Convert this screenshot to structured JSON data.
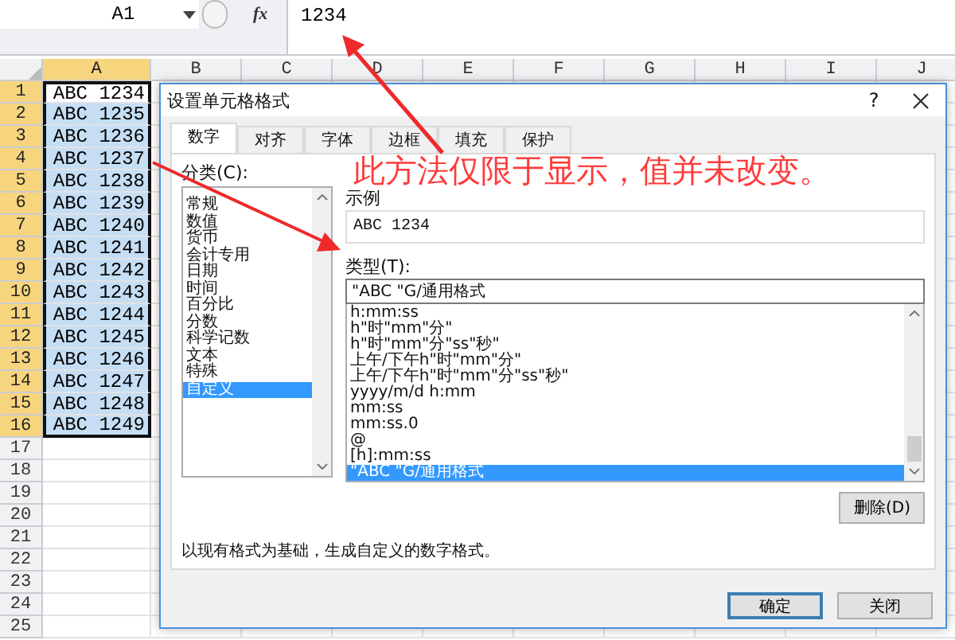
{
  "formula_bar": {
    "name_box": "A1",
    "function_label": "fx",
    "value": "1234"
  },
  "sheet": {
    "columns": [
      {
        "label": "A",
        "selected": true
      },
      {
        "label": "B",
        "selected": false
      },
      {
        "label": "C",
        "selected": false
      },
      {
        "label": "D",
        "selected": false
      },
      {
        "label": "E",
        "selected": false
      },
      {
        "label": "F",
        "selected": false
      },
      {
        "label": "G",
        "selected": false
      },
      {
        "label": "H",
        "selected": false
      },
      {
        "label": "I",
        "selected": false
      },
      {
        "label": "J",
        "selected": false
      }
    ],
    "rows": [
      {
        "label": "1",
        "selected": true,
        "active": true,
        "cell": "ABC 1234"
      },
      {
        "label": "2",
        "selected": true,
        "active": false,
        "cell": "ABC 1235"
      },
      {
        "label": "3",
        "selected": true,
        "active": false,
        "cell": "ABC 1236"
      },
      {
        "label": "4",
        "selected": true,
        "active": false,
        "cell": "ABC 1237"
      },
      {
        "label": "5",
        "selected": true,
        "active": false,
        "cell": "ABC 1238"
      },
      {
        "label": "6",
        "selected": true,
        "active": false,
        "cell": "ABC 1239"
      },
      {
        "label": "7",
        "selected": true,
        "active": false,
        "cell": "ABC 1240"
      },
      {
        "label": "8",
        "selected": true,
        "active": false,
        "cell": "ABC 1241"
      },
      {
        "label": "9",
        "selected": true,
        "active": false,
        "cell": "ABC 1242"
      },
      {
        "label": "10",
        "selected": true,
        "active": false,
        "cell": "ABC 1243"
      },
      {
        "label": "11",
        "selected": true,
        "active": false,
        "cell": "ABC 1244"
      },
      {
        "label": "12",
        "selected": true,
        "active": false,
        "cell": "ABC 1245"
      },
      {
        "label": "13",
        "selected": true,
        "active": false,
        "cell": "ABC 1246"
      },
      {
        "label": "14",
        "selected": true,
        "active": false,
        "cell": "ABC 1247"
      },
      {
        "label": "15",
        "selected": true,
        "active": false,
        "cell": "ABC 1248"
      },
      {
        "label": "16",
        "selected": true,
        "active": false,
        "cell": "ABC 1249"
      },
      {
        "label": "17",
        "selected": false,
        "active": false
      },
      {
        "label": "18",
        "selected": false,
        "active": false
      },
      {
        "label": "19",
        "selected": false,
        "active": false
      },
      {
        "label": "20",
        "selected": false,
        "active": false
      },
      {
        "label": "21",
        "selected": false,
        "active": false
      },
      {
        "label": "22",
        "selected": false,
        "active": false
      },
      {
        "label": "23",
        "selected": false,
        "active": false
      },
      {
        "label": "24",
        "selected": false,
        "active": false
      },
      {
        "label": "25",
        "selected": false,
        "active": false
      }
    ]
  },
  "dialog": {
    "title": "设置单元格格式",
    "help": "?",
    "tabs": [
      {
        "label": "数字",
        "selected": true
      },
      {
        "label": "对齐",
        "selected": false
      },
      {
        "label": "字体",
        "selected": false
      },
      {
        "label": "边框",
        "selected": false
      },
      {
        "label": "填充",
        "selected": false
      },
      {
        "label": "保护",
        "selected": false
      }
    ],
    "category_label": "分类(C):",
    "categories": [
      {
        "label": "常规",
        "selected": false
      },
      {
        "label": "数值",
        "selected": false
      },
      {
        "label": "货币",
        "selected": false
      },
      {
        "label": "会计专用",
        "selected": false
      },
      {
        "label": "日期",
        "selected": false
      },
      {
        "label": "时间",
        "selected": false
      },
      {
        "label": "百分比",
        "selected": false
      },
      {
        "label": "分数",
        "selected": false
      },
      {
        "label": "科学记数",
        "selected": false
      },
      {
        "label": "文本",
        "selected": false
      },
      {
        "label": "特殊",
        "selected": false
      },
      {
        "label": "自定义",
        "selected": true
      }
    ],
    "sample_label": "示例",
    "sample": "ABC 1234",
    "type_label": "类型(T):",
    "type_value": "\"ABC \"G/通用格式",
    "type_list": [
      {
        "label": "h:mm:ss",
        "selected": false
      },
      {
        "label": "h\"时\"mm\"分\"",
        "selected": false
      },
      {
        "label": "h\"时\"mm\"分\"ss\"秒\"",
        "selected": false
      },
      {
        "label": "上午/下午h\"时\"mm\"分\"",
        "selected": false
      },
      {
        "label": "上午/下午h\"时\"mm\"分\"ss\"秒\"",
        "selected": false
      },
      {
        "label": "yyyy/m/d h:mm",
        "selected": false
      },
      {
        "label": "mm:ss",
        "selected": false
      },
      {
        "label": "mm:ss.0",
        "selected": false
      },
      {
        "label": "@",
        "selected": false
      },
      {
        "label": "[h]:mm:ss",
        "selected": false
      },
      {
        "label": "\"ABC \"G/通用格式",
        "selected": true
      }
    ],
    "delete_button": "删除(D)",
    "description": "以现有格式为基础，生成自定义的数字格式。",
    "buttons": [
      {
        "label": "确定",
        "default": true
      },
      {
        "label": "关闭",
        "default": false
      }
    ]
  },
  "annotation": {
    "text": "此方法仅限于显示，值并未改变。"
  }
}
